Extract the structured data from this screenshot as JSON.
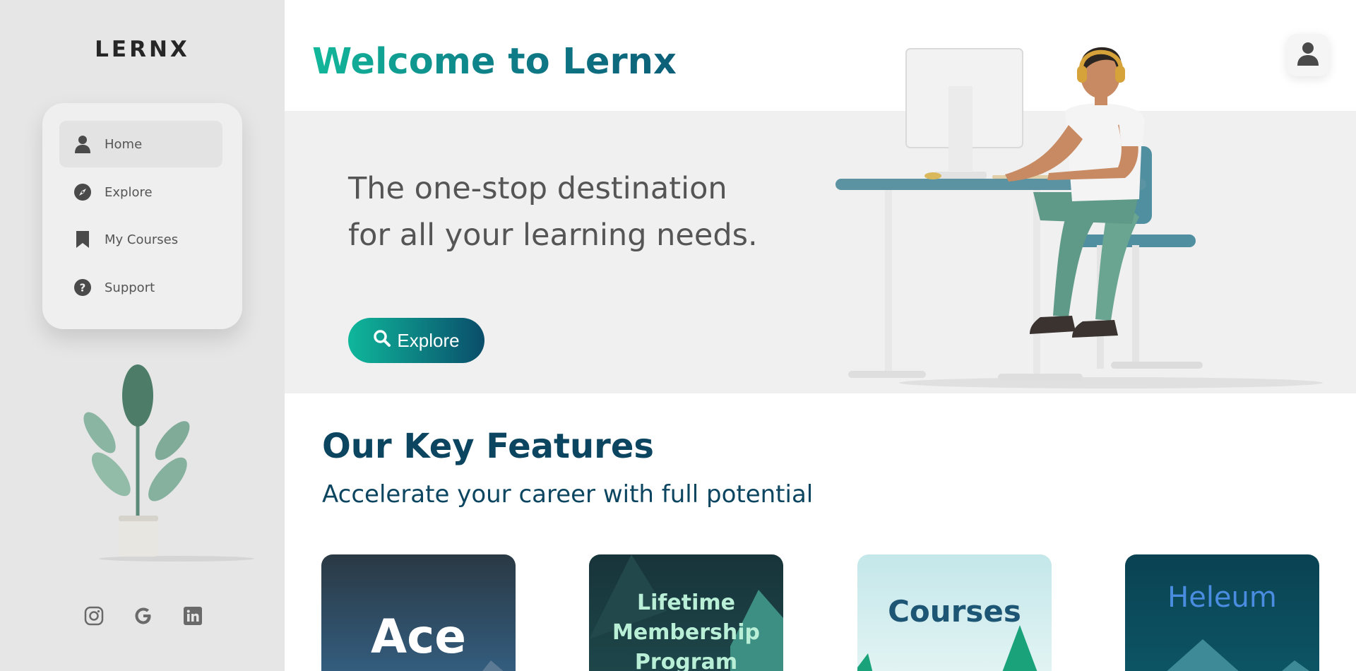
{
  "sidebar": {
    "logo": "LERNX",
    "nav": [
      {
        "label": "Home",
        "icon": "user-icon",
        "active": true
      },
      {
        "label": "Explore",
        "icon": "compass-icon",
        "active": false
      },
      {
        "label": "My Courses",
        "icon": "bookmark-icon",
        "active": false
      },
      {
        "label": "Support",
        "icon": "question-circle-icon",
        "active": false
      }
    ],
    "socials": [
      "instagram-icon",
      "google-icon",
      "linkedin-icon"
    ]
  },
  "header": {
    "title": "Welcome to Lernx",
    "profile_icon": "user-icon"
  },
  "hero": {
    "tagline": "The one-stop destination for all your learning needs.",
    "explore_label": "Explore",
    "explore_icon": "search-icon"
  },
  "features": {
    "title": "Our Key Features",
    "subtitle": "Accelerate your career with full potential",
    "cards": [
      {
        "label": "Ace",
        "bg": "#2d4d63"
      },
      {
        "label": "Lifetime Membership Program",
        "bg": "#1f4a4d"
      },
      {
        "label": "Courses",
        "bg": "#d6eeef"
      },
      {
        "label": "Heleum",
        "bg": "#0b4957"
      }
    ]
  },
  "colors": {
    "accent_start": "#12b89a",
    "accent_end": "#0c5f78",
    "heading": "#0c4560"
  }
}
